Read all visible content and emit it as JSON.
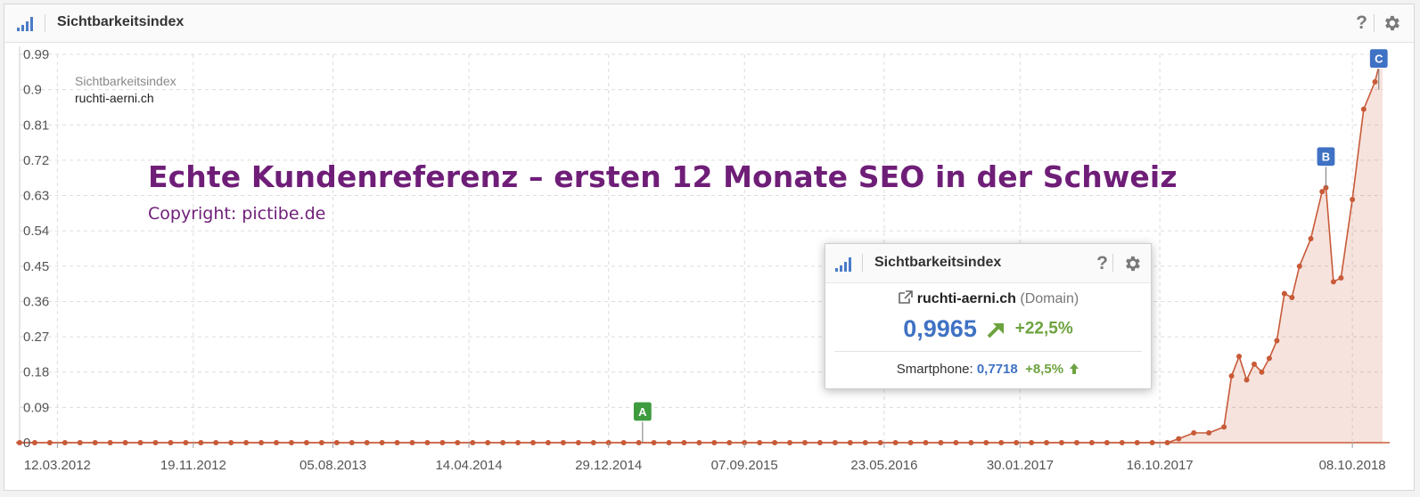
{
  "header": {
    "title": "Sichtbarkeitsindex"
  },
  "chart_data": {
    "type": "area",
    "title": "Sichtbarkeitsindex",
    "series": [
      {
        "name": "ruchti-aerni.ch",
        "color": "#c85a38"
      }
    ],
    "x_start": "2012-01-02",
    "x_end": "2018-12-03",
    "x_tick_labels": [
      "12.03.2012",
      "19.11.2012",
      "05.08.2013",
      "14.04.2014",
      "29.12.2014",
      "07.09.2015",
      "23.05.2016",
      "30.01.2017",
      "16.10.2017",
      "08.10.2018"
    ],
    "y_ticks": [
      0,
      0.09,
      0.18,
      0.27,
      0.36,
      0.45,
      0.54,
      0.63,
      0.72,
      0.81,
      0.9,
      0.99
    ],
    "y_tick_labels": [
      "0",
      "0.09",
      "0.18",
      "0.27",
      "0.36",
      "0.45",
      "0.54",
      "0.63",
      "0.72",
      "0.81",
      "0.9",
      "0.99"
    ],
    "ylim": [
      0,
      0.99
    ],
    "grid": true,
    "flat_points": {
      "start": "2012-01-02",
      "end": "2017-10-16",
      "step_weeks": 4,
      "value": 0
    },
    "points": [
      {
        "x": "2017-10-30",
        "y": 0
      },
      {
        "x": "2017-11-20",
        "y": 0.01
      },
      {
        "x": "2017-12-18",
        "y": 0.025
      },
      {
        "x": "2018-01-15",
        "y": 0.025
      },
      {
        "x": "2018-02-12",
        "y": 0.04
      },
      {
        "x": "2018-02-26",
        "y": 0.17
      },
      {
        "x": "2018-03-12",
        "y": 0.22
      },
      {
        "x": "2018-03-26",
        "y": 0.16
      },
      {
        "x": "2018-04-09",
        "y": 0.2
      },
      {
        "x": "2018-04-23",
        "y": 0.18
      },
      {
        "x": "2018-05-07",
        "y": 0.215
      },
      {
        "x": "2018-05-21",
        "y": 0.26
      },
      {
        "x": "2018-06-04",
        "y": 0.38
      },
      {
        "x": "2018-06-18",
        "y": 0.37
      },
      {
        "x": "2018-07-02",
        "y": 0.45
      },
      {
        "x": "2018-07-23",
        "y": 0.52
      },
      {
        "x": "2018-08-13",
        "y": 0.64
      },
      {
        "x": "2018-08-20",
        "y": 0.65
      },
      {
        "x": "2018-09-03",
        "y": 0.41
      },
      {
        "x": "2018-09-17",
        "y": 0.42
      },
      {
        "x": "2018-10-08",
        "y": 0.62
      },
      {
        "x": "2018-10-29",
        "y": 0.85
      },
      {
        "x": "2018-11-19",
        "y": 0.92
      },
      {
        "x": "2018-12-03",
        "y": 0.9965
      }
    ],
    "markers": [
      {
        "label": "A",
        "x": "2015-03-02",
        "y": 0,
        "color": "#3e9b3e"
      },
      {
        "label": "B",
        "x": "2018-08-20",
        "y": 0.65,
        "color": "#3f72c4"
      },
      {
        "label": "C",
        "x": "2018-11-26",
        "y": 0.9,
        "color": "#3f72c4"
      }
    ]
  },
  "legend": {
    "title": "Sichtbarkeitsindex",
    "domain": "ruchti-aerni.ch"
  },
  "overlay": {
    "title": "Echte Kundenreferenz – ersten 12 Monate SEO in der Schweiz",
    "copyright": "Copyright: pictibe.de"
  },
  "popup": {
    "title": "Sichtbarkeitsindex",
    "domain": "ruchti-aerni.ch",
    "domain_type": "(Domain)",
    "value": "0,9965",
    "change": "+22,5%",
    "smartphone_label": "Smartphone:",
    "smartphone_value": "0,7718",
    "smartphone_change": "+8,5%"
  },
  "colors": {
    "accent_blue": "#3f72c4",
    "positive_green": "#6da33f",
    "line": "#c85a38",
    "overlay_text": "#6f1e78"
  },
  "icons": [
    "bar-chart-icon",
    "help-icon",
    "gear-icon",
    "external-link-icon",
    "trend-up-arrow-icon",
    "up-arrow-icon"
  ]
}
